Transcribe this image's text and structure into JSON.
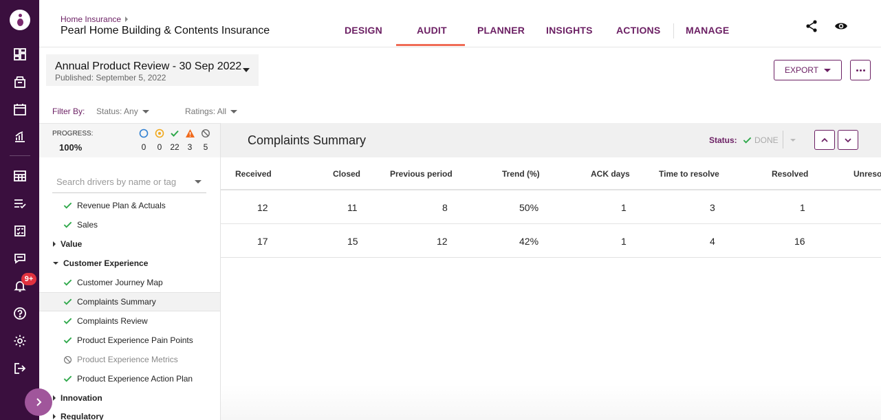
{
  "rail": {
    "icons": [
      "dashboard-icon",
      "box-icon",
      "calendar-icon",
      "chart-icon",
      "table-icon",
      "checklist-icon",
      "task-icon",
      "chat-icon",
      "bell-icon",
      "help-icon",
      "settings-icon",
      "logout-icon"
    ],
    "notification_badge": "9+"
  },
  "header": {
    "breadcrumb": "Home Insurance",
    "title": "Pearl Home Building & Contents Insurance",
    "tabs": [
      {
        "label": "DESIGN",
        "active": false
      },
      {
        "label": "AUDIT",
        "active": true
      },
      {
        "label": "PLANNER",
        "active": false
      },
      {
        "label": "INSIGHTS",
        "active": false
      },
      {
        "label": "ACTIONS",
        "active": false
      },
      {
        "label": "MANAGE",
        "active": false
      }
    ],
    "accent_color": "#ef6b55",
    "brand_color": "#6b1f63"
  },
  "review": {
    "title": "Annual Product Review - 30 Sep 2022",
    "published": "Published: September 5, 2022"
  },
  "filters": {
    "label": "Filter By:",
    "status": "Status: Any",
    "ratings": "Ratings: All"
  },
  "progress": {
    "label": "PROGRESS:",
    "value": "100%",
    "stats": [
      {
        "icon": "circle-icon",
        "count": "0"
      },
      {
        "icon": "in-progress-icon",
        "count": "0"
      },
      {
        "icon": "check-icon",
        "count": "22"
      },
      {
        "icon": "warning-icon",
        "count": "3"
      },
      {
        "icon": "na-icon",
        "count": "5"
      }
    ]
  },
  "search": {
    "placeholder": "Search drivers by name or tag"
  },
  "tree": [
    {
      "label": "Revenue Plan & Actuals",
      "type": "leaf",
      "status": "done"
    },
    {
      "label": "Sales",
      "type": "leaf",
      "status": "done"
    },
    {
      "label": "Value",
      "type": "group",
      "expanded": false
    },
    {
      "label": "Customer Experience",
      "type": "group",
      "expanded": true
    },
    {
      "label": "Customer Journey Map",
      "type": "leaf",
      "status": "done"
    },
    {
      "label": "Complaints Summary",
      "type": "leaf",
      "status": "done",
      "selected": true
    },
    {
      "label": "Complaints Review",
      "type": "leaf",
      "status": "done"
    },
    {
      "label": "Product Experience Pain Points",
      "type": "leaf",
      "status": "done"
    },
    {
      "label": "Product Experience Metrics",
      "type": "leaf",
      "status": "na"
    },
    {
      "label": "Product Experience Action Plan",
      "type": "leaf",
      "status": "done"
    },
    {
      "label": "Innovation",
      "type": "group",
      "expanded": false
    },
    {
      "label": "Regulatory",
      "type": "group",
      "expanded": false
    }
  ],
  "toolbar": {
    "export_label": "EXPORT"
  },
  "section": {
    "title": "Complaints Summary",
    "status_label": "Status:",
    "status_value": "DONE"
  },
  "table": {
    "columns": [
      "Received",
      "Closed",
      "Previous period",
      "Trend (%)",
      "ACK days",
      "Time to resolve",
      "Resolved",
      "Unresolved"
    ],
    "rows": [
      [
        "12",
        "11",
        "8",
        "50%",
        "1",
        "3",
        "1",
        ""
      ],
      [
        "17",
        "15",
        "12",
        "42%",
        "1",
        "4",
        "16",
        ""
      ]
    ]
  }
}
